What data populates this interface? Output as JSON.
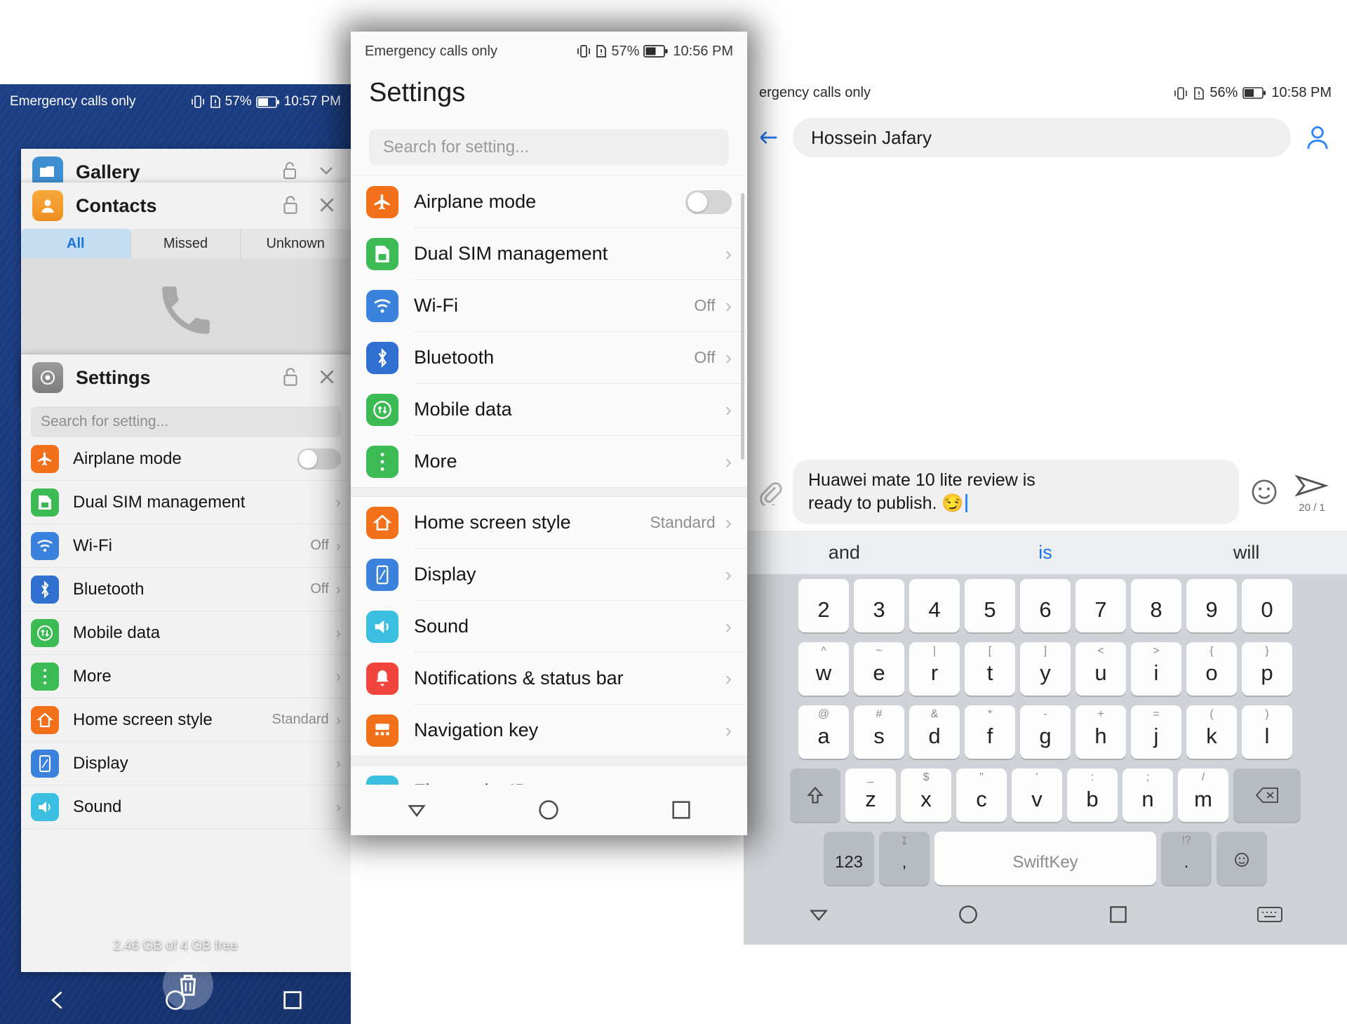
{
  "left_panel": {
    "status": {
      "carrier": "Emergency calls only",
      "battery_percent": "57%",
      "time": "10:57 PM"
    },
    "cards": [
      {
        "name": "Gallery"
      },
      {
        "name": "Contacts"
      },
      {
        "name": "Settings"
      }
    ],
    "contacts": {
      "tabs": [
        "All",
        "Missed",
        "Unknown"
      ],
      "active_tab": "All"
    },
    "settings": {
      "search_placeholder": "Search for setting...",
      "rows": [
        {
          "label": "Airplane mode",
          "value": "",
          "control": "toggle"
        },
        {
          "label": "Dual SIM management",
          "value": "",
          "control": "chevron"
        },
        {
          "label": "Wi-Fi",
          "value": "Off",
          "control": "chevron"
        },
        {
          "label": "Bluetooth",
          "value": "Off",
          "control": "chevron"
        },
        {
          "label": "Mobile data",
          "value": "",
          "control": "chevron"
        },
        {
          "label": "More",
          "value": "",
          "control": "chevron"
        },
        {
          "label": "Home screen style",
          "value": "Standard",
          "control": "chevron"
        },
        {
          "label": "Display",
          "value": "",
          "control": "chevron"
        },
        {
          "label": "Sound",
          "value": "",
          "control": "chevron"
        }
      ]
    },
    "memory": "2.46 GB of 4 GB free"
  },
  "center_panel": {
    "status": {
      "carrier": "Emergency calls only",
      "battery_percent": "57%",
      "time": "10:56 PM"
    },
    "title": "Settings",
    "search_placeholder": "Search for setting...",
    "groups": [
      {
        "rows": [
          {
            "label": "Airplane mode",
            "value": "",
            "control": "toggle",
            "icon": "airplane-icon",
            "color": "#f3701b"
          },
          {
            "label": "Dual SIM management",
            "value": "",
            "control": "chevron",
            "icon": "sim-card-icon",
            "color": "#3cba54"
          },
          {
            "label": "Wi-Fi",
            "value": "Off",
            "control": "chevron",
            "icon": "wifi-icon",
            "color": "#3b82dd"
          },
          {
            "label": "Bluetooth",
            "value": "Off",
            "control": "chevron",
            "icon": "bluetooth-icon",
            "color": "#2f6fd0"
          },
          {
            "label": "Mobile data",
            "value": "",
            "control": "chevron",
            "icon": "mobile-data-icon",
            "color": "#3cba54"
          },
          {
            "label": "More",
            "value": "",
            "control": "chevron",
            "icon": "more-dots-icon",
            "color": "#3cba54"
          }
        ]
      },
      {
        "rows": [
          {
            "label": "Home screen style",
            "value": "Standard",
            "control": "chevron",
            "icon": "home-icon",
            "color": "#f3701b"
          },
          {
            "label": "Display",
            "value": "",
            "control": "chevron",
            "icon": "display-icon",
            "color": "#3b82dd"
          },
          {
            "label": "Sound",
            "value": "",
            "control": "chevron",
            "icon": "sound-icon",
            "color": "#3bbfe0"
          },
          {
            "label": "Notifications & status bar",
            "value": "",
            "control": "chevron",
            "icon": "bell-icon",
            "color": "#f0443c"
          },
          {
            "label": "Navigation key",
            "value": "",
            "control": "chevron",
            "icon": "navigation-key-icon",
            "color": "#f3701b"
          }
        ]
      },
      {
        "rows": [
          {
            "label": "Fingerprint ID",
            "value": "",
            "control": "chevron",
            "icon": "fingerprint-icon",
            "color": "#3bbfe0"
          }
        ]
      }
    ]
  },
  "right_panel": {
    "status": {
      "carrier": "ergency calls only",
      "battery_percent": "56%",
      "time": "10:58 PM"
    },
    "recipient": "Hossein Jafary",
    "message_line1": "Huawei mate 10 lite review is",
    "message_line2": "ready to publish. 😏",
    "char_counter": "20 / 1",
    "keyboard": {
      "predictions": [
        "and",
        "is",
        "will"
      ],
      "prediction_highlight": "is",
      "row_numbers": [
        "2",
        "3",
        "4",
        "5",
        "6",
        "7",
        "8",
        "9",
        "0"
      ],
      "row_qwerty": [
        {
          "main": "w",
          "alt": "^"
        },
        {
          "main": "e",
          "alt": "~"
        },
        {
          "main": "r",
          "alt": "|"
        },
        {
          "main": "t",
          "alt": "["
        },
        {
          "main": "y",
          "alt": "]"
        },
        {
          "main": "u",
          "alt": "<"
        },
        {
          "main": "i",
          "alt": ">"
        },
        {
          "main": "o",
          "alt": "{"
        },
        {
          "main": "p",
          "alt": "}"
        }
      ],
      "row_asdf": [
        {
          "main": "a",
          "alt": "@"
        },
        {
          "main": "s",
          "alt": "#"
        },
        {
          "main": "d",
          "alt": "&"
        },
        {
          "main": "f",
          "alt": "*"
        },
        {
          "main": "g",
          "alt": "-"
        },
        {
          "main": "h",
          "alt": "+"
        },
        {
          "main": "j",
          "alt": "="
        },
        {
          "main": "k",
          "alt": "("
        },
        {
          "main": "l",
          "alt": ")"
        }
      ],
      "row_zxcv": [
        {
          "main": "z",
          "alt": "_"
        },
        {
          "main": "x",
          "alt": "$"
        },
        {
          "main": "c",
          "alt": "\""
        },
        {
          "main": "v",
          "alt": "'"
        },
        {
          "main": "b",
          "alt": ":"
        },
        {
          "main": "n",
          "alt": ";"
        },
        {
          "main": "m",
          "alt": "/"
        }
      ],
      "symbol_key": "123",
      "comma_key": ",",
      "space_label": "SwiftKey",
      "period_key": ".",
      "period_alt": "!?"
    }
  }
}
